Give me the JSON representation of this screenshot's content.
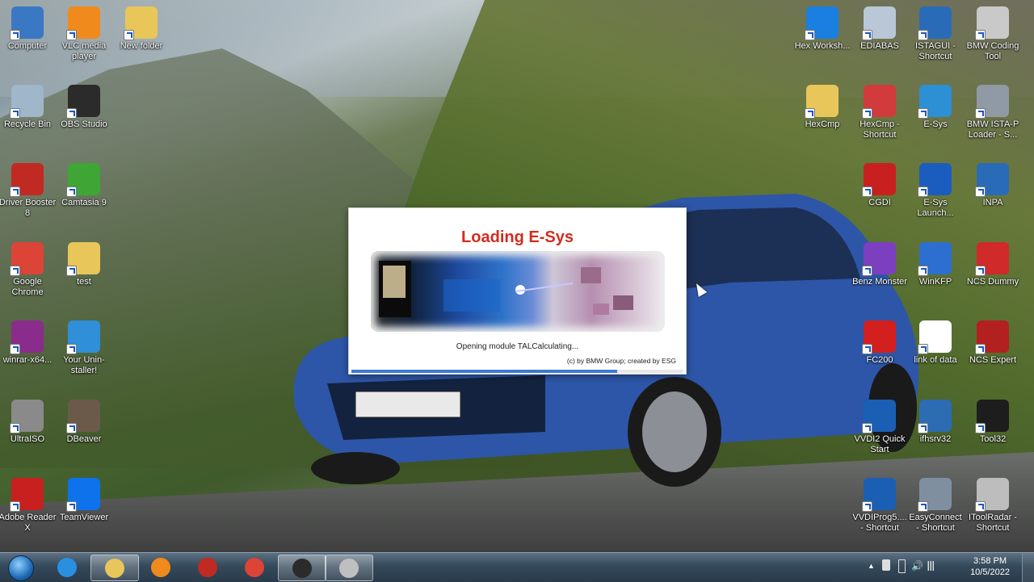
{
  "desktop": {
    "left_icons": [
      {
        "label": "Computer",
        "name": "computer-icon",
        "color": "#3b78c4"
      },
      {
        "label": "VLC media player",
        "name": "vlc-icon",
        "color": "#f08a1c"
      },
      {
        "label": "New folder",
        "name": "folder-icon",
        "color": "#e8c65a"
      },
      {
        "label": "Recycle Bin",
        "name": "recycle-bin-icon",
        "color": "#9fb7c8"
      },
      {
        "label": "OBS Studio",
        "name": "obs-icon",
        "color": "#2b2b2b"
      },
      {
        "label": "Driver Booster 8",
        "name": "driver-booster-icon",
        "color": "#c12a22"
      },
      {
        "label": "Camtasia 9",
        "name": "camtasia-icon",
        "color": "#3fa535"
      },
      {
        "label": "Google Chrome",
        "name": "chrome-icon",
        "color": "#db4437"
      },
      {
        "label": "test",
        "name": "folder-icon",
        "color": "#e8c65a"
      },
      {
        "label": "winrar-x64...",
        "name": "winrar-icon",
        "color": "#8a2c8c"
      },
      {
        "label": "Your Unin-staller!",
        "name": "uninstaller-icon",
        "color": "#2f8fd8"
      },
      {
        "label": "UltraISO",
        "name": "ultraiso-icon",
        "color": "#8a8a8a"
      },
      {
        "label": "DBeaver",
        "name": "dbeaver-icon",
        "color": "#6b5a4a"
      },
      {
        "label": "Adobe Reader X",
        "name": "adobe-reader-icon",
        "color": "#c8201e"
      },
      {
        "label": "TeamViewer",
        "name": "teamviewer-icon",
        "color": "#0e72ed"
      }
    ],
    "right_icons": [
      {
        "label": "Hex Worksh...",
        "name": "hex-workshop-icon",
        "color": "#1a7fe0"
      },
      {
        "label": "EDIABAS",
        "name": "ediabas-icon",
        "color": "#b9c7d6"
      },
      {
        "label": "ISTAGUI - Shortcut",
        "name": "bmw-logo-icon",
        "color": "#2a6bb8"
      },
      {
        "label": "BMW Coding Tool",
        "name": "bmw-coding-tool-icon",
        "color": "#c9c9c9"
      },
      {
        "label": "HexCmp",
        "name": "folder-icon",
        "color": "#e8c65a"
      },
      {
        "label": "HexCmp - Shortcut",
        "name": "hexcmp-icon",
        "color": "#d23b3b"
      },
      {
        "label": "E-Sys",
        "name": "esys-icon",
        "color": "#2d8fd4"
      },
      {
        "label": "BMW ISTA-P Loader - S...",
        "name": "ista-p-icon",
        "color": "#8f9aa5"
      },
      {
        "label": "CGDI",
        "name": "cgdi-icon",
        "color": "#c8201e"
      },
      {
        "label": "E-Sys Launch...",
        "name": "esys-launcher-icon",
        "color": "#1b5cbf"
      },
      {
        "label": "INPA",
        "name": "bmw-logo-icon",
        "color": "#2a6bb8"
      },
      {
        "label": "Benz Monster",
        "name": "benz-monster-icon",
        "color": "#7b3fbf"
      },
      {
        "label": "WinKFP",
        "name": "winkfp-icon",
        "color": "#2d6fd0"
      },
      {
        "label": "NCS Dummy",
        "name": "ncs-dummy-icon",
        "color": "#d02a2a"
      },
      {
        "label": "FC200",
        "name": "fc200-icon",
        "color": "#d41f1f"
      },
      {
        "label": "link of data",
        "name": "text-file-icon",
        "color": "#ffffff"
      },
      {
        "label": "NCS Expert",
        "name": "ncs-expert-icon",
        "color": "#b32020"
      },
      {
        "label": "VVDI2 Quick Start",
        "name": "vvdi2-icon",
        "color": "#1a5fb4"
      },
      {
        "label": "ifhsrv32",
        "name": "ifhsrv32-icon",
        "color": "#2b6cb3"
      },
      {
        "label": "Tool32",
        "name": "tool32-icon",
        "color": "#1d1d1d"
      },
      {
        "label": "VVDIProg5.... - Shortcut",
        "name": "vvdiprog-icon",
        "color": "#1a5fb4"
      },
      {
        "label": "EasyConnect - Shortcut",
        "name": "easyconnect-icon",
        "color": "#7f8fa0"
      },
      {
        "label": "IToolRadar - Shortcut",
        "name": "itoolradar-icon",
        "color": "#bdbdbd"
      }
    ]
  },
  "dialog": {
    "title": "Loading E-Sys",
    "status": "Opening module TALCalculating...",
    "copyright": "(c) by BMW Group; created by ESG",
    "progress": 0.8
  },
  "taskbar": {
    "apps": [
      {
        "name": "ie-icon",
        "color": "#2b8fe0",
        "active": false
      },
      {
        "name": "explorer-icon",
        "color": "#e8c65a",
        "active": true
      },
      {
        "name": "media-player-icon",
        "color": "#f08a1c",
        "active": false
      },
      {
        "name": "driver-booster-icon",
        "color": "#c12a22",
        "active": false
      },
      {
        "name": "chrome-icon",
        "color": "#db4437",
        "active": false
      },
      {
        "name": "obs-icon",
        "color": "#2b2b2b",
        "active": true
      },
      {
        "name": "esys-app-icon",
        "color": "#bfbfbf",
        "active": true
      }
    ],
    "time": "3:58 PM",
    "date": "10/5/2022"
  }
}
